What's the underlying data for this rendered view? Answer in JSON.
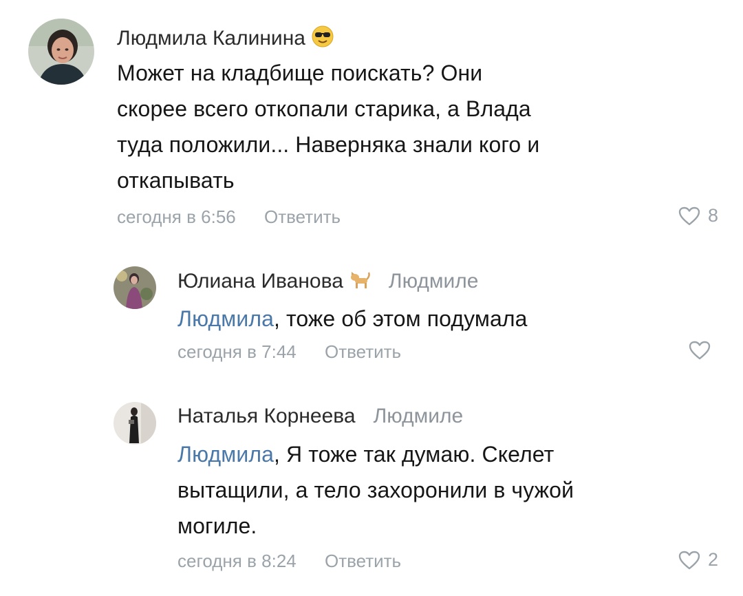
{
  "comments": [
    {
      "author": "Людмила Калинина",
      "emoji": "sunglasses-emoji",
      "reply_to": "",
      "mention": "",
      "text": "Может на кладбище поискать? Они скорее всего откопали старика, а Влада туда положили... Наверняка знали кого и откапывать",
      "text_lines": [
        "Может на кладбище поискать? Они",
        "скорее всего откопали старика, а Влада",
        "туда положили... Наверняка знали кого и",
        "откапывать"
      ],
      "time": "сегодня в 6:56",
      "reply_label": "Ответить",
      "likes": "8"
    },
    {
      "author": "Юлиана Иванова",
      "emoji": "cat-emoji",
      "reply_to": "Людмиле",
      "mention": "Людмила",
      "text_lines": [
        ", тоже об этом подумала"
      ],
      "time": "сегодня в 7:44",
      "reply_label": "Ответить",
      "likes": ""
    },
    {
      "author": "Наталья Корнеева",
      "emoji": "",
      "reply_to": "Людмиле",
      "mention": "Людмила",
      "text_lines": [
        ", Я тоже так думаю. Скелет",
        "вытащили, а тело захоронили в чужой",
        "могиле."
      ],
      "time": "сегодня в 8:24",
      "reply_label": "Ответить",
      "likes": "2"
    }
  ],
  "colors": {
    "author": "#2b2b2b",
    "text": "#161616",
    "meta": "#9ba3aa",
    "mention": "#4a78a8"
  }
}
